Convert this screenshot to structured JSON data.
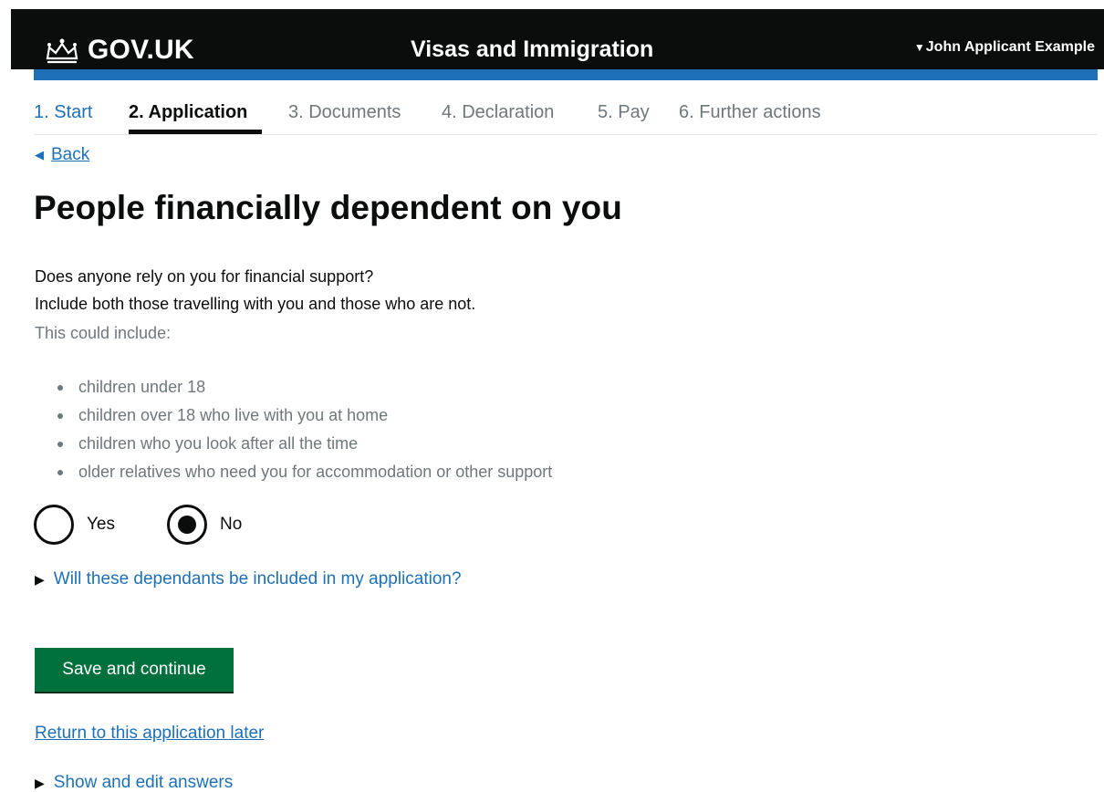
{
  "header": {
    "brand": "GOV.UK",
    "service_name": "Visas and Immigration",
    "account_name": "John Applicant Example",
    "colors": {
      "header_bg": "#0b0c0c",
      "accent_bar": "#1d70b8"
    }
  },
  "steps": [
    {
      "label": "1. Start",
      "state": "done"
    },
    {
      "label": "2. Application",
      "state": "current"
    },
    {
      "label": "3. Documents",
      "state": "upcoming"
    },
    {
      "label": "4. Declaration",
      "state": "upcoming"
    },
    {
      "label": "5. Pay",
      "state": "upcoming"
    },
    {
      "label": "6. Further actions",
      "state": "upcoming"
    }
  ],
  "back_link": "Back",
  "page_title": "People financially dependent on you",
  "question": {
    "line1": "Does anyone rely on you for financial support?",
    "line2": "Include both those travelling with you and those who are not.",
    "hint": "This could include:",
    "bullets": [
      "children under 18",
      "children over 18 who live with you at home",
      "children who you look after all the time",
      "older relatives who need you for accommodation or other support"
    ]
  },
  "radios": {
    "yes_label": "Yes",
    "no_label": "No",
    "selected": "No"
  },
  "details_summary": "Will these dependants be included in my application?",
  "save_button": "Save and continue",
  "return_later_link": "Return to this application later",
  "show_answers": "Show and edit answers",
  "icons": {
    "brand": "crown-icon",
    "account": "caret-down-icon",
    "back": "triangle-left-icon",
    "details": "triangle-right-icon"
  },
  "colors": {
    "link": "#1d70b8",
    "button": "#00703c",
    "secondary_text": "#6f777b"
  }
}
